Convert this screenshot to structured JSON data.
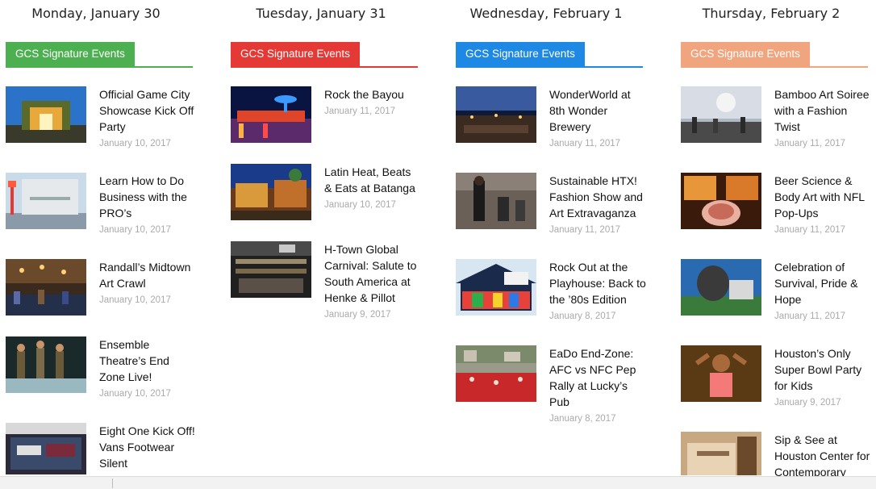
{
  "columns": [
    {
      "day": "Monday, January 30",
      "category": "GCS Signature Events",
      "accent": "#4caf50",
      "posts": [
        {
          "title": "Official Game City Showcase Kick Off Party",
          "date": "January 10, 2017"
        },
        {
          "title": "Learn How to Do Business with the PRO’s",
          "date": "January 10, 2017"
        },
        {
          "title": "Randall’s Midtown Art Crawl",
          "date": "January 10, 2017"
        },
        {
          "title": "Ensemble Theatre’s End Zone Live!",
          "date": "January 10, 2017"
        },
        {
          "title": "Eight One Kick Off! Vans Footwear Silent",
          "date": ""
        }
      ]
    },
    {
      "day": "Tuesday, January 31",
      "category": "GCS Signature Events",
      "accent": "#e53935",
      "posts": [
        {
          "title": "Rock the Bayou",
          "date": "January 11, 2017"
        },
        {
          "title": "Latin Heat, Beats & Eats at Batanga",
          "date": "January 10, 2017"
        },
        {
          "title": "H-Town Global Carnival: Salute to South America at Henke & Pillot",
          "date": "January 9, 2017"
        }
      ]
    },
    {
      "day": "Wednesday, February 1",
      "category": "GCS Signature Events",
      "accent": "#1e88e5",
      "posts": [
        {
          "title": "WonderWorld at 8th Wonder Brewery",
          "date": "January 11, 2017"
        },
        {
          "title": "Sustainable HTX! Fashion Show and Art Extravaganza",
          "date": "January 11, 2017"
        },
        {
          "title": "Rock Out at the Playhouse: Back to the ’80s Edition",
          "date": "January 8, 2017"
        },
        {
          "title": "EaDo End-Zone: AFC vs NFC Pep Rally at Lucky’s Pub",
          "date": "January 8, 2017"
        }
      ]
    },
    {
      "day": "Thursday, February 2",
      "category": "GCS Signature Events",
      "accent": "#f0a57f",
      "posts": [
        {
          "title": "Bamboo Art Soiree with a Fashion Twist",
          "date": "January 11, 2017"
        },
        {
          "title": "Beer Science & Body Art with NFL Pop-Ups",
          "date": "January 11, 2017"
        },
        {
          "title": "Celebration of Survival, Pride & Hope",
          "date": "January 11, 2017"
        },
        {
          "title": "Houston’s Only Super Bowl Party for Kids",
          "date": "January 9, 2017"
        },
        {
          "title": "Sip & See at Houston Center for Contemporary",
          "date": ""
        }
      ]
    }
  ]
}
